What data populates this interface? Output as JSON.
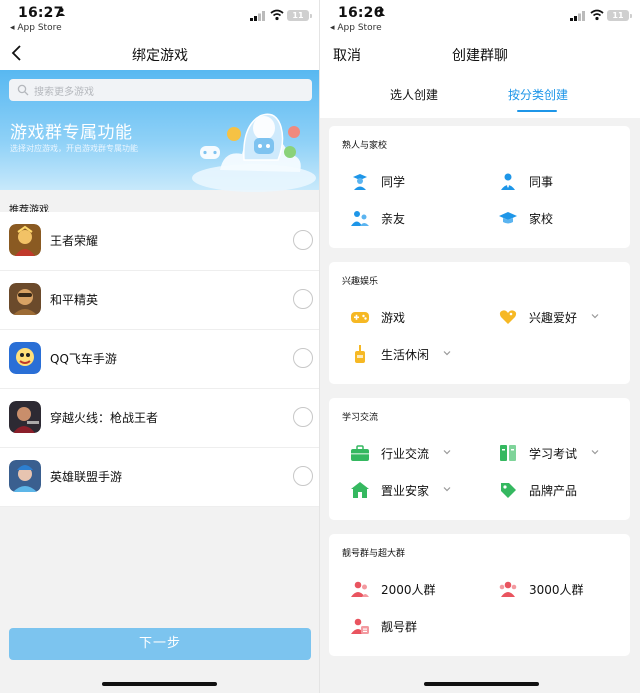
{
  "left": {
    "status": {
      "time": "16:27",
      "back_app": "◂ App Store",
      "battery": "11"
    },
    "nav_title": "绑定游戏",
    "search_placeholder": "搜索更多游戏",
    "banner": {
      "title": "游戏群专属功能",
      "subtitle": "选择对应游戏，开启游戏群专属功能"
    },
    "section_label": "推荐游戏",
    "games": [
      {
        "name": "王者荣耀",
        "icon": "honor-of-kings-icon"
      },
      {
        "name": "和平精英",
        "icon": "peace-elite-icon"
      },
      {
        "name": "QQ飞车手游",
        "icon": "qq-speed-icon"
      },
      {
        "name": "穿越火线：枪战王者",
        "icon": "crossfire-icon"
      },
      {
        "name": "英雄联盟手游",
        "icon": "league-of-legends-icon"
      }
    ],
    "next_label": "下一步"
  },
  "right": {
    "status": {
      "time": "16:26",
      "back_app": "◂ App Store",
      "battery": "11"
    },
    "cancel_label": "取消",
    "nav_title": "创建群聊",
    "tabs": [
      {
        "label": "选人创建",
        "active": false
      },
      {
        "label": "按分类创建",
        "active": true
      }
    ],
    "sections": [
      {
        "title": "熟人与家校",
        "items": [
          {
            "label": "同学",
            "icon": "graduate-icon",
            "dropdown": false
          },
          {
            "label": "同事",
            "icon": "colleague-icon",
            "dropdown": false
          },
          {
            "label": "亲友",
            "icon": "family-icon",
            "dropdown": false
          },
          {
            "label": "家校",
            "icon": "school-cap-icon",
            "dropdown": false
          }
        ]
      },
      {
        "title": "兴趣娱乐",
        "items": [
          {
            "label": "游戏",
            "icon": "gamepad-icon",
            "dropdown": false
          },
          {
            "label": "兴趣爱好",
            "icon": "heart-icon",
            "dropdown": true
          },
          {
            "label": "生活休闲",
            "icon": "drink-icon",
            "dropdown": true
          }
        ]
      },
      {
        "title": "学习交流",
        "items": [
          {
            "label": "行业交流",
            "icon": "briefcase-icon",
            "dropdown": true
          },
          {
            "label": "学习考试",
            "icon": "book-icon",
            "dropdown": true
          },
          {
            "label": "置业安家",
            "icon": "house-icon",
            "dropdown": true
          },
          {
            "label": "品牌产品",
            "icon": "tag-icon",
            "dropdown": false
          }
        ]
      },
      {
        "title": "靓号群与超大群",
        "items": [
          {
            "label": "2000人群",
            "icon": "group-2000-icon",
            "dropdown": false
          },
          {
            "label": "3000人群",
            "icon": "group-3000-icon",
            "dropdown": false
          },
          {
            "label": "靓号群",
            "icon": "vip-group-icon",
            "dropdown": false
          }
        ]
      }
    ]
  },
  "colors": {
    "accent": "#1e96e8",
    "next_button": "#7cc4ef",
    "banner": "#58b8f1",
    "divider": "#eeeeee"
  }
}
